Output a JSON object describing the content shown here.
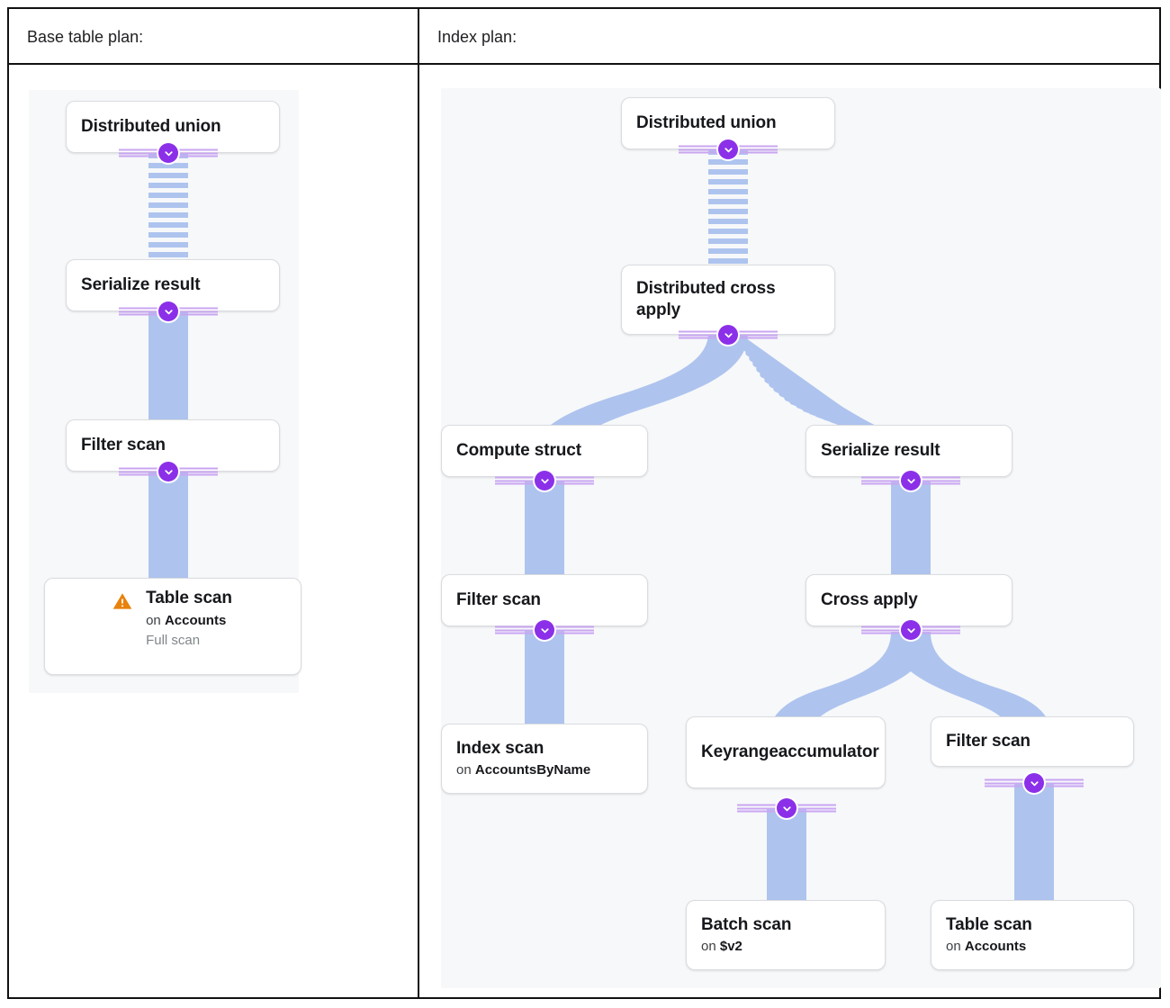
{
  "table": {
    "columns": [
      {
        "header": "Base table plan:"
      },
      {
        "header": "Index plan:"
      }
    ]
  },
  "colors": {
    "node_border": "#dadce0",
    "node_bg": "#ffffff",
    "canvas_bg": "#f7f8fa",
    "edge": "#aec4ee",
    "connector": "#8b30e8",
    "connector_rail": "#c9a6f2",
    "warning": "#e8820c",
    "table_border": "#111111",
    "text": "#16181c",
    "muted_text": "#80868b"
  },
  "base_table_plan": {
    "title": "Base table plan:",
    "nodes": [
      {
        "id": "bt-distributed-union",
        "title": "Distributed union"
      },
      {
        "id": "bt-serialize-result",
        "title": "Serialize result"
      },
      {
        "id": "bt-filter-scan",
        "title": "Filter scan"
      },
      {
        "id": "bt-table-scan",
        "title": "Table scan",
        "sub_prefix": "on ",
        "sub_value": "Accounts",
        "detail": "Full scan",
        "warning": true
      }
    ],
    "edges": [
      {
        "from": "bt-distributed-union",
        "to": "bt-serialize-result",
        "style": "striped"
      },
      {
        "from": "bt-serialize-result",
        "to": "bt-filter-scan",
        "style": "solid"
      },
      {
        "from": "bt-filter-scan",
        "to": "bt-table-scan",
        "style": "solid"
      }
    ]
  },
  "index_plan": {
    "title": "Index plan:",
    "nodes": [
      {
        "id": "ix-distributed-union",
        "title": "Distributed union"
      },
      {
        "id": "ix-distributed-cross-apply",
        "title": "Distributed cross apply"
      },
      {
        "id": "ix-compute-struct",
        "title": "Compute struct"
      },
      {
        "id": "ix-serialize-result",
        "title": "Serialize result"
      },
      {
        "id": "ix-filter-scan-left",
        "title": "Filter scan"
      },
      {
        "id": "ix-cross-apply",
        "title": "Cross apply"
      },
      {
        "id": "ix-index-scan",
        "title": "Index scan",
        "sub_prefix": "on ",
        "sub_value": "AccountsByName"
      },
      {
        "id": "ix-keyrange-accumulator",
        "title": "Keyrangeaccumulator"
      },
      {
        "id": "ix-filter-scan-right",
        "title": "Filter scan"
      },
      {
        "id": "ix-batch-scan",
        "title": "Batch scan",
        "sub_prefix": "on ",
        "sub_value": "$v2"
      },
      {
        "id": "ix-table-scan",
        "title": "Table scan",
        "sub_prefix": "on ",
        "sub_value": "Accounts"
      }
    ],
    "edges": [
      {
        "from": "ix-distributed-union",
        "to": "ix-distributed-cross-apply",
        "style": "striped"
      },
      {
        "from": "ix-distributed-cross-apply",
        "to": "ix-compute-struct",
        "style": "solid"
      },
      {
        "from": "ix-distributed-cross-apply",
        "to": "ix-serialize-result",
        "style": "striped-fan"
      },
      {
        "from": "ix-compute-struct",
        "to": "ix-filter-scan-left",
        "style": "solid"
      },
      {
        "from": "ix-serialize-result",
        "to": "ix-cross-apply",
        "style": "solid"
      },
      {
        "from": "ix-filter-scan-left",
        "to": "ix-index-scan",
        "style": "solid"
      },
      {
        "from": "ix-cross-apply",
        "to": "ix-keyrange-accumulator",
        "style": "solid"
      },
      {
        "from": "ix-cross-apply",
        "to": "ix-filter-scan-right",
        "style": "solid"
      },
      {
        "from": "ix-keyrange-accumulator",
        "to": "ix-batch-scan",
        "style": "solid"
      },
      {
        "from": "ix-filter-scan-right",
        "to": "ix-table-scan",
        "style": "solid"
      }
    ]
  },
  "icons": {
    "warning": "warning-triangle-icon",
    "connector": "chevron-down-icon"
  }
}
